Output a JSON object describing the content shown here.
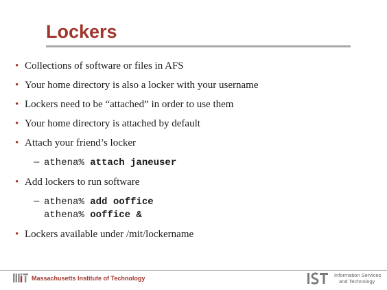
{
  "slide": {
    "title": "Lockers",
    "bullets": [
      "Collections of software or files in AFS",
      "Your home directory is also a locker with your username",
      "Lockers need to be “attached” in order to use them",
      "Your home directory is attached by default",
      "Attach your friend’s locker",
      "Add lockers to run software",
      "Lockers available under /mit/lockername"
    ],
    "bullet_glyph": "•",
    "sub_glyph": "–",
    "examples": {
      "attach": {
        "prompt": "athena%",
        "command": "attach janeuser"
      },
      "add": [
        {
          "prompt": "athena%",
          "command": "add ooffice"
        },
        {
          "prompt": "athena%",
          "command": "ooffice &"
        }
      ]
    }
  },
  "footer": {
    "institution": "Massachusetts Institute of Technology",
    "department_line1": "Information Services",
    "department_line2": "and Technology",
    "logo_text_mit": "MIT",
    "logo_text_ist": "IST"
  },
  "colors": {
    "accent": "#a0362d",
    "rule": "#a9a9a9",
    "text": "#1a1a1a"
  }
}
